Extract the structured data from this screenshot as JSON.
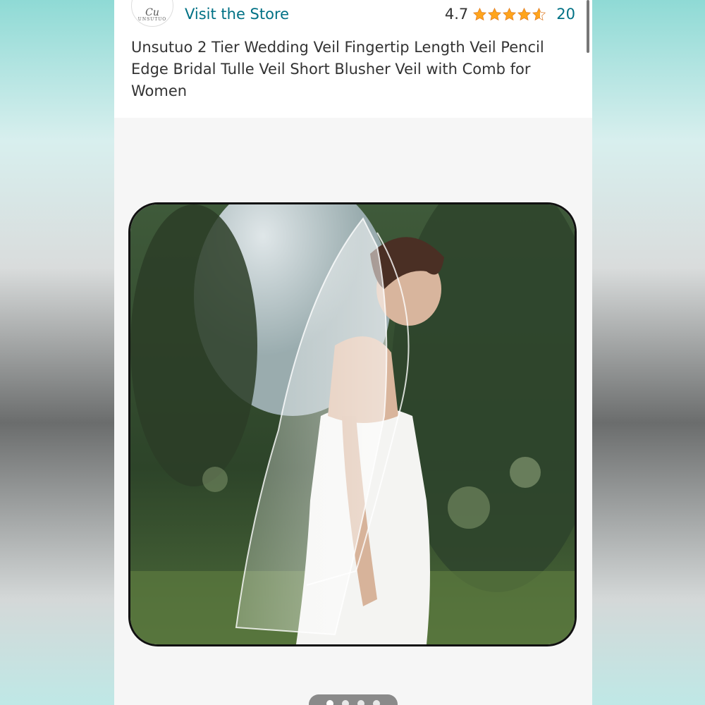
{
  "store": {
    "logo_mark": "Cu",
    "logo_word": "UNSUTUO",
    "visit_label": "Visit the Store"
  },
  "rating": {
    "value": "4.7",
    "stars": 4.7,
    "review_count": "20",
    "star_color": "#ffa41c"
  },
  "product": {
    "title": "Unsutuo 2 Tier Wedding Veil Fingertip Length Veil Pencil Edge Bridal Tulle Veil Short Blusher Veil with Comb for Women",
    "image_icon": "bride-veil-photo"
  },
  "carousel": {
    "count": 4,
    "active_index": 0
  },
  "colors": {
    "link": "#007185",
    "text": "#333333"
  }
}
